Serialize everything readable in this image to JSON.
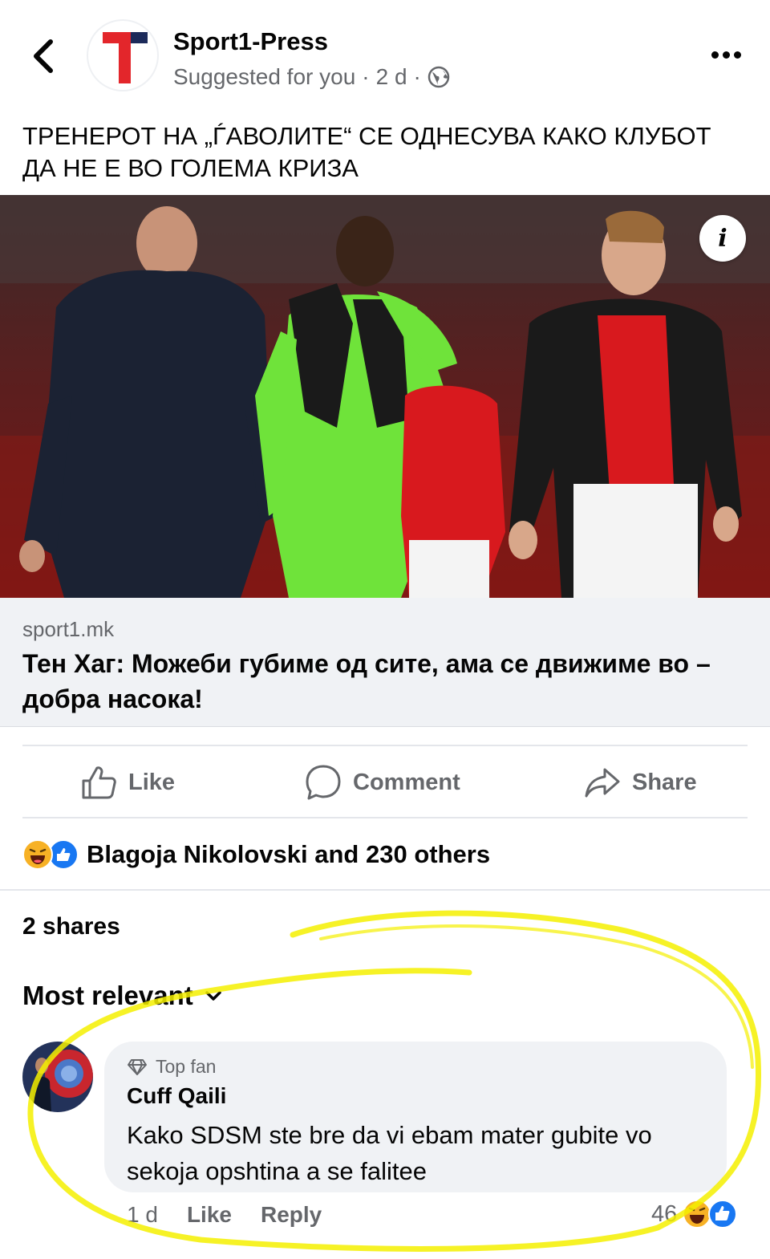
{
  "header": {
    "back_label": "Back",
    "page_name": "Sport1-Press",
    "suggested": "Suggested for you",
    "separator": "·",
    "time": "2 d",
    "privacy_icon": "globe-icon",
    "more_icon": "more-horizontal-icon"
  },
  "post": {
    "text": "ТРЕНЕРОТ НА „ЃАВОЛИТЕ“ СЕ ОДНЕСУВА КАКО КЛУБОТ ДА НЕ Е ВО ГОЛЕМА КРИЗА",
    "info_glyph": "i"
  },
  "link": {
    "domain": "sport1.mk",
    "title": "Тен Хаг: Можеби губиме од сите, ама се движиме во – добра насока!"
  },
  "actions": {
    "like": "Like",
    "comment": "Comment",
    "share": "Share"
  },
  "reactions": {
    "summary": "Blagoja Nikolovski and 230 others"
  },
  "shares": "2 shares",
  "comments": {
    "sort_label": "Most relevant",
    "items": [
      {
        "badge": "Top fan",
        "author": "Cuff Qaili",
        "text": "Kako SDSM ste bre da vi ebam mater gubite vo sekoja opshtina a se falitee",
        "time": "1 d",
        "like": "Like",
        "reply": "Reply",
        "reaction_count": "46"
      }
    ]
  },
  "colors": {
    "accent_blue": "#1877f2",
    "secondary_text": "#65676b",
    "card_bg": "#f0f2f5",
    "highlight_yellow": "#f5f000"
  }
}
